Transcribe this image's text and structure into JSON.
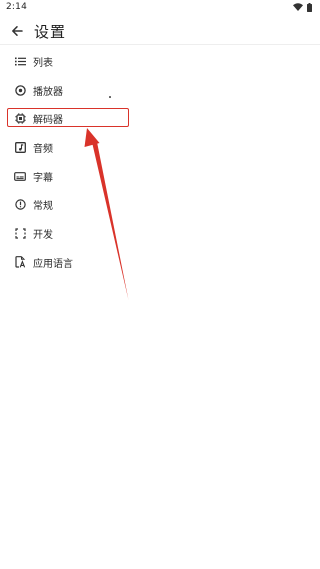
{
  "status_bar": {
    "time": "2:14",
    "icons": [
      "wifi-icon",
      "battery-icon"
    ]
  },
  "app_bar": {
    "title": "设置",
    "back_icon": "arrow-left-icon"
  },
  "menu": {
    "items": [
      {
        "label": "列表",
        "icon": "list-icon"
      },
      {
        "label": "播放器",
        "icon": "player-icon"
      },
      {
        "label": "解码器",
        "icon": "chip-icon"
      },
      {
        "label": "音频",
        "icon": "audio-icon"
      },
      {
        "label": "字幕",
        "icon": "subtitle-icon"
      },
      {
        "label": "常规",
        "icon": "info-icon"
      },
      {
        "label": "开发",
        "icon": "developer-icon"
      },
      {
        "label": "应用语言",
        "icon": "language-icon"
      }
    ]
  },
  "annotation": {
    "highlight_color": "#d9332a",
    "highlighted_item": "解码器"
  }
}
